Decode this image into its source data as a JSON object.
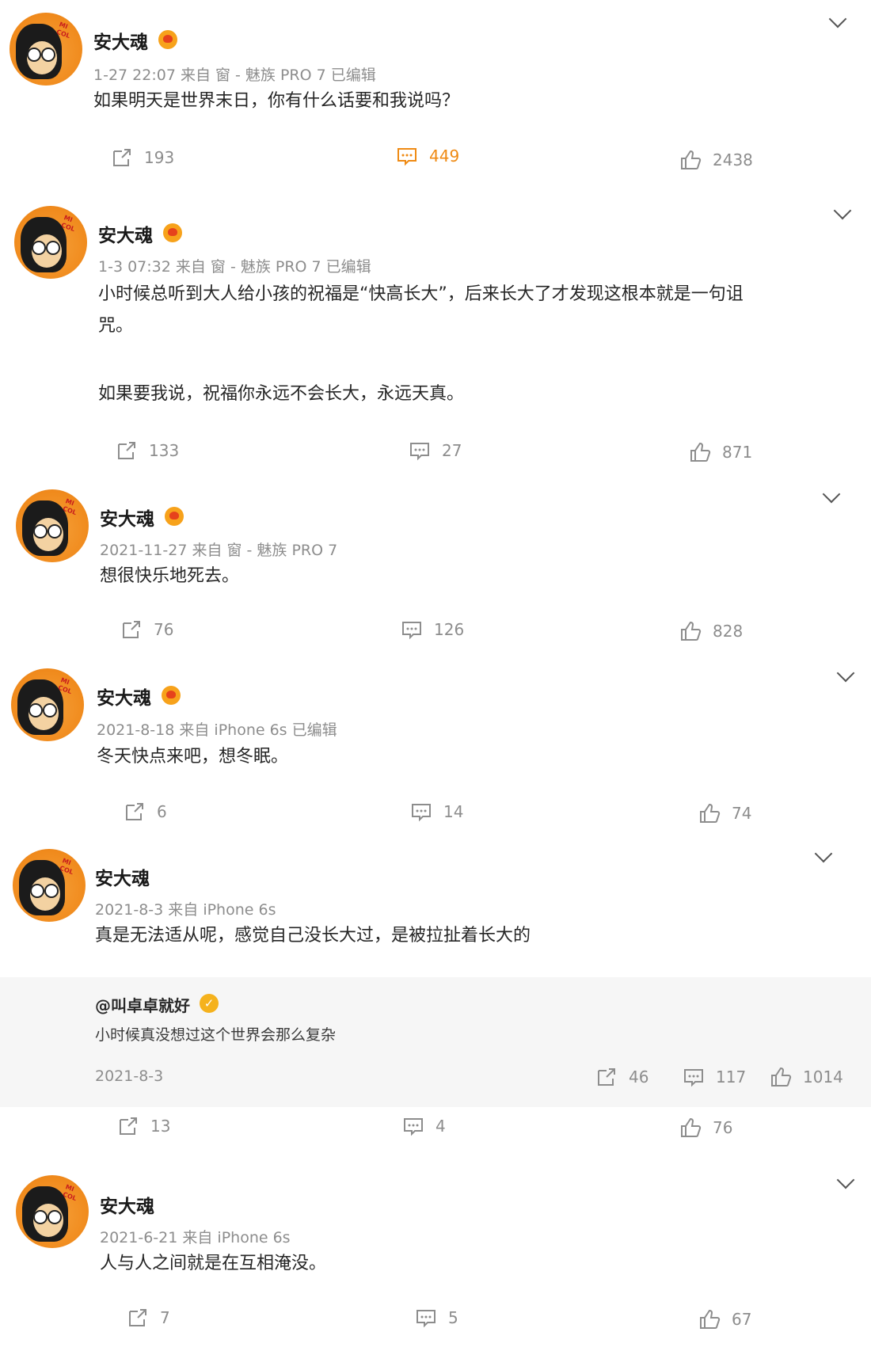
{
  "posts": [
    {
      "author": "安大魂",
      "meta": "1-27 22:07  来自 窗 - 魅族 PRO 7 已编辑",
      "text": [
        "如果明天是世界末日，你有什么话要和我说吗？"
      ],
      "reposts": "193",
      "comments": "449",
      "likes": "2438"
    },
    {
      "author": "安大魂",
      "meta": "1-3 07:32  来自 窗 - 魅族 PRO 7 已编辑",
      "text": [
        "小时候总听到大人给小孩的祝福是“快高长大”，后来长大了才发现这根本就是一句诅",
        "咒。",
        "",
        "如果要我说，祝福你永远不会长大，永远天真。"
      ],
      "reposts": "133",
      "comments": "27",
      "likes": "871"
    },
    {
      "author": "安大魂",
      "meta": "2021-11-27  来自 窗 - 魅族 PRO 7",
      "text": [
        "想很快乐地死去。"
      ],
      "reposts": "76",
      "comments": "126",
      "likes": "828"
    },
    {
      "author": "安大魂",
      "meta": "2021-8-18  来自 iPhone 6s 已编辑",
      "text": [
        "冬天快点来吧，想冬眠。"
      ],
      "reposts": "6",
      "comments": "14",
      "likes": "74"
    },
    {
      "author": "安大魂",
      "meta": "2021-8-3  来自 iPhone 6s",
      "text": [
        "真是无法适从呢，感觉自己没长大过，是被拉扯着长大的"
      ],
      "quote": {
        "author": "@叫卓卓就好",
        "text": "小时候真没想过这个世界会那么复杂",
        "date": "2021-8-3",
        "reposts": "46",
        "comments": "117",
        "likes": "1014"
      },
      "reposts": "13",
      "comments": "4",
      "likes": "76"
    },
    {
      "author": "安大魂",
      "meta": "2021-6-21  来自 iPhone 6s",
      "text": [
        "人与人之间就是在互相淹没。"
      ],
      "reposts": "7",
      "comments": "5",
      "likes": "67"
    }
  ],
  "colors": {
    "accent": "#ef8a13",
    "meta": "#8d8d8d"
  },
  "icons": [
    "repost-icon",
    "comment-icon",
    "like-icon",
    "chevron-down-icon",
    "vip-badge-icon",
    "verified-icon"
  ]
}
